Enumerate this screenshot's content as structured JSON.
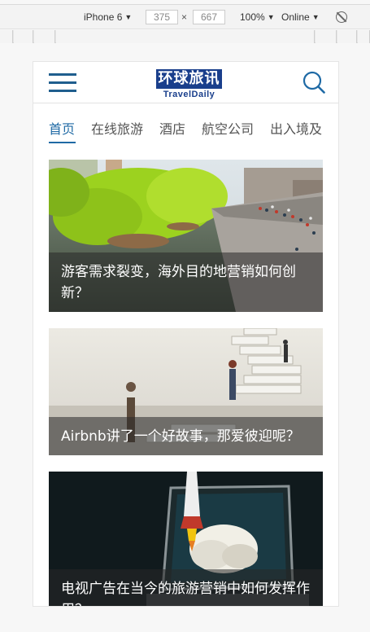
{
  "devtools": {
    "device": "iPhone 6",
    "width": "375",
    "times": "×",
    "height": "667",
    "zoom": "100%",
    "network": "Online",
    "caret": "▼"
  },
  "header": {
    "logo_cn": "环球旅讯",
    "logo_en": "TravelDaily",
    "brand_color": "#1f5e8e"
  },
  "tabs": [
    {
      "label": "首页",
      "active": true
    },
    {
      "label": "在线旅游",
      "active": false
    },
    {
      "label": "酒店",
      "active": false
    },
    {
      "label": "航空公司",
      "active": false
    },
    {
      "label": "出入境及",
      "active": false
    }
  ],
  "articles": [
    {
      "title": "游客需求裂变，海外目的地营销如何创新？"
    },
    {
      "title": "Airbnb讲了一个好故事，那爱彼迎呢？"
    },
    {
      "title": "电视广告在当今的旅游营销中如何发挥作用？"
    }
  ]
}
